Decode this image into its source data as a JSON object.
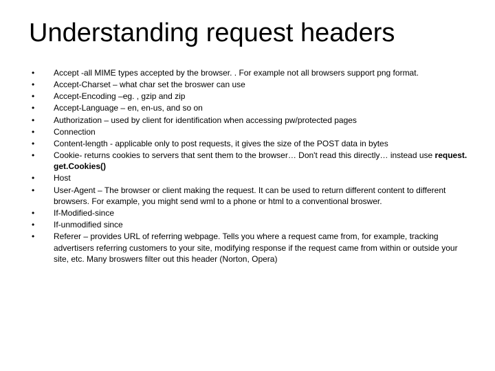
{
  "title": "Understanding request headers",
  "items": [
    "Accept  -all MIME types accepted by the browser. . For example not all browsers support png format.",
    "Accept-Charset – what char set the broswer can use",
    "Accept-Encoding –eg. , gzip and zip",
    "Accept-Language – en, en-us, and so on",
    "Authorization – used by client for identification when accessing pw/protected pages",
    "Connection",
    "Content-length  - applicable only to post requests, it gives the size of the POST data in bytes",
    "Cookie- returns cookies to servers that sent them to the browser… Don't read this directly… instead use ",
    "Host",
    "User-Agent – The browser or client making the request. It can be used to return different content to different browsers.  For example, you might send wml to a phone or html to a conventional broswer.",
    "If-Modified-since",
    "If-unmodified since",
    "Referer – provides URL of referring webpage. Tells you where a request came from, for example, tracking advertisers referring customers to your site, modifying response if the request came from within or outside your site, etc. Many broswers filter out this header (Norton, Opera)"
  ],
  "cookie_bold_suffix": "request. get.Cookies()"
}
